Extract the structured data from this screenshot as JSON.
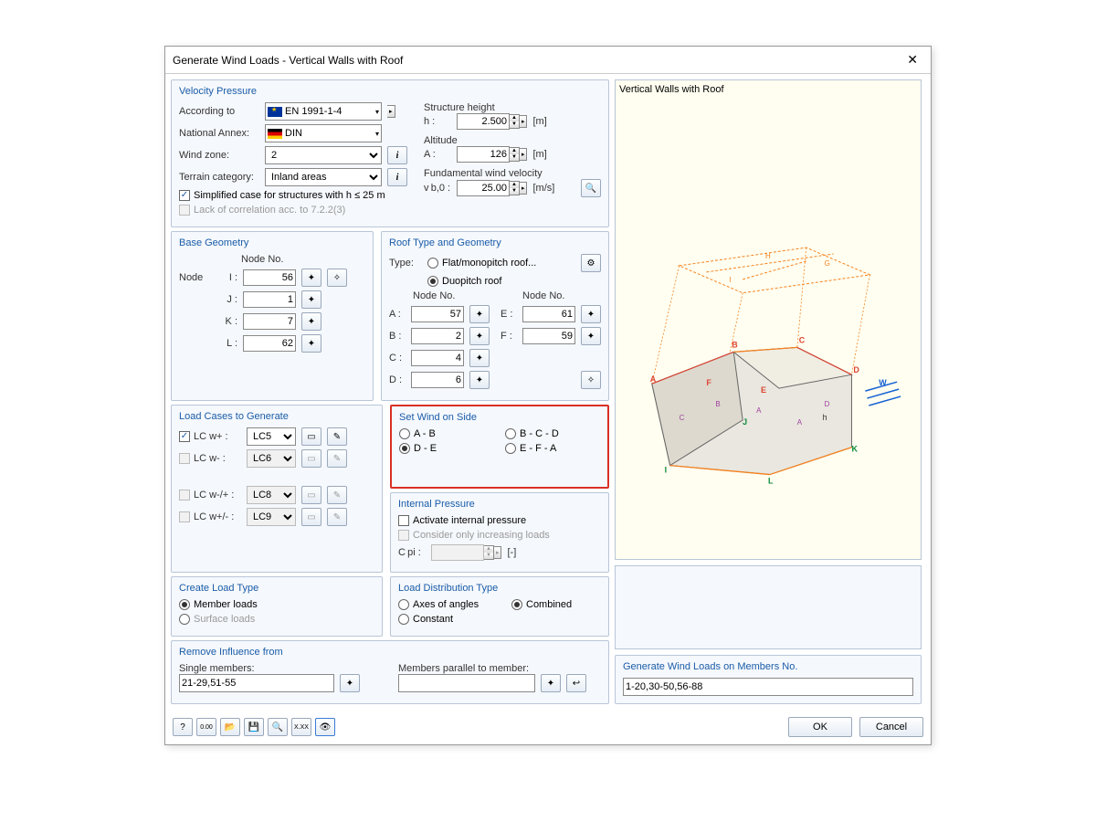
{
  "window": {
    "title": "Generate Wind Loads  -  Vertical Walls with Roof"
  },
  "vp": {
    "title": "Velocity Pressure",
    "according_label": "According to",
    "according_value": "EN 1991-1-4",
    "annex_label": "National Annex:",
    "annex_value": "DIN",
    "zone_label": "Wind zone:",
    "zone_value": "2",
    "terrain_label": "Terrain category:",
    "terrain_value": "Inland areas",
    "simplified": "Simplified case for structures with h ≤ 25 m",
    "lack": "Lack of correlation acc. to 7.2.2(3)",
    "sh_label": "Structure height",
    "h_label": "h :",
    "h_value": "2.500",
    "h_unit": "[m]",
    "alt_label": "Altitude",
    "a_label": "A :",
    "a_value": "126",
    "a_unit": "[m]",
    "fwv_label": "Fundamental wind velocity",
    "vb_label": "v b,0 :",
    "vb_value": "25.00",
    "vb_unit": "[m/s]"
  },
  "bg": {
    "title": "Base Geometry",
    "nodeno": "Node No.",
    "node": "Node",
    "I": "I :",
    "I_v": "56",
    "J": "J :",
    "J_v": "1",
    "K": "K :",
    "K_v": "7",
    "L": "L :",
    "L_v": "62"
  },
  "rt": {
    "title": "Roof Type and Geometry",
    "type": "Type:",
    "flat": "Flat/monopitch roof...",
    "duo": "Duopitch roof",
    "nodeno": "Node No.",
    "A": "A :",
    "A_v": "57",
    "B": "B :",
    "B_v": "2",
    "C": "C :",
    "C_v": "4",
    "D": "D :",
    "D_v": "6",
    "E": "E :",
    "E_v": "61",
    "F": "F :",
    "F_v": "59"
  },
  "lc": {
    "title": "Load Cases to Generate",
    "wp": "LC w+ :",
    "wp_v": "LC5",
    "wm": "LC w- :",
    "wm_v": "LC6",
    "wmp": "LC w-/+ :",
    "wmp_v": "LC8",
    "wpm": "LC w+/- :",
    "wpm_v": "LC9"
  },
  "wind": {
    "title": "Set Wind on Side",
    "ab": "A - B",
    "bcd": "B - C - D",
    "de": "D - E",
    "efa": "E - F - A"
  },
  "ip": {
    "title": "Internal Pressure",
    "activate": "Activate internal pressure",
    "consider": "Consider only increasing loads",
    "cpi": "C pi :",
    "unit": "[-]"
  },
  "clt": {
    "title": "Create Load Type",
    "member": "Member loads",
    "surface": "Surface loads"
  },
  "ldt": {
    "title": "Load Distribution Type",
    "axes": "Axes of angles",
    "combined": "Combined",
    "constant": "Constant"
  },
  "ri": {
    "title": "Remove Influence from",
    "single": "Single members:",
    "single_v": "21-29,51-55",
    "parallel": "Members parallel to member:",
    "parallel_v": ""
  },
  "preview": {
    "title": "Vertical Walls with Roof"
  },
  "gen": {
    "title": "Generate Wind Loads on Members No.",
    "value": "1-20,30-50,56-88"
  },
  "footer": {
    "ok": "OK",
    "cancel": "Cancel"
  }
}
